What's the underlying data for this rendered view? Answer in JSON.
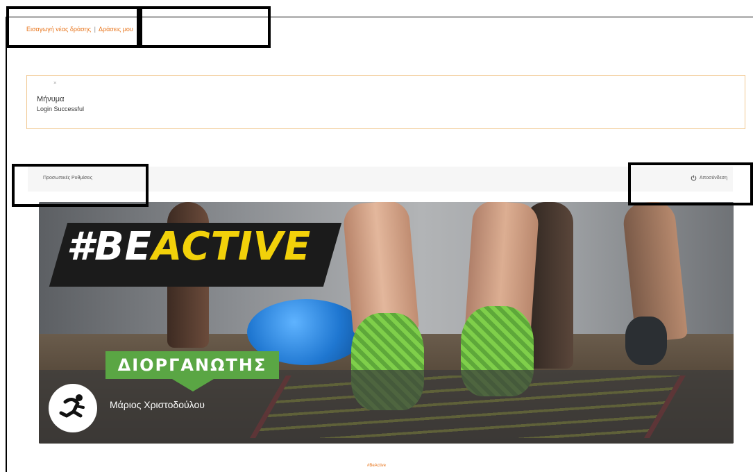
{
  "nav": {
    "link_add_event": "Εισαγωγή νέας δράσης",
    "separator": "|",
    "link_my_events": "Δράσεις μου"
  },
  "message": {
    "close_symbol": "×",
    "title": "Μήνυμα",
    "text": "Login Successful"
  },
  "user_bar": {
    "settings_label": "Προσωπικές Ρυθμίσεις",
    "logout_label": "Αποσύνδεση",
    "logout_icon": "power-icon"
  },
  "banner": {
    "headline_prefix": "#BE",
    "headline_accent": "ACTIVE",
    "organizer_badge": "ΔΙΟΡΓΑΝΩΤΗΣ",
    "organizer_name": "Μάριος Χριστοδούλου",
    "organizer_icon": "runner-icon",
    "colors": {
      "accent_yellow": "#f2d10a",
      "badge_green": "#5aa644"
    }
  },
  "footer": {
    "text": "#BeActive"
  },
  "theme": {
    "link_color": "#e8741a",
    "message_border": "#f1c891"
  }
}
